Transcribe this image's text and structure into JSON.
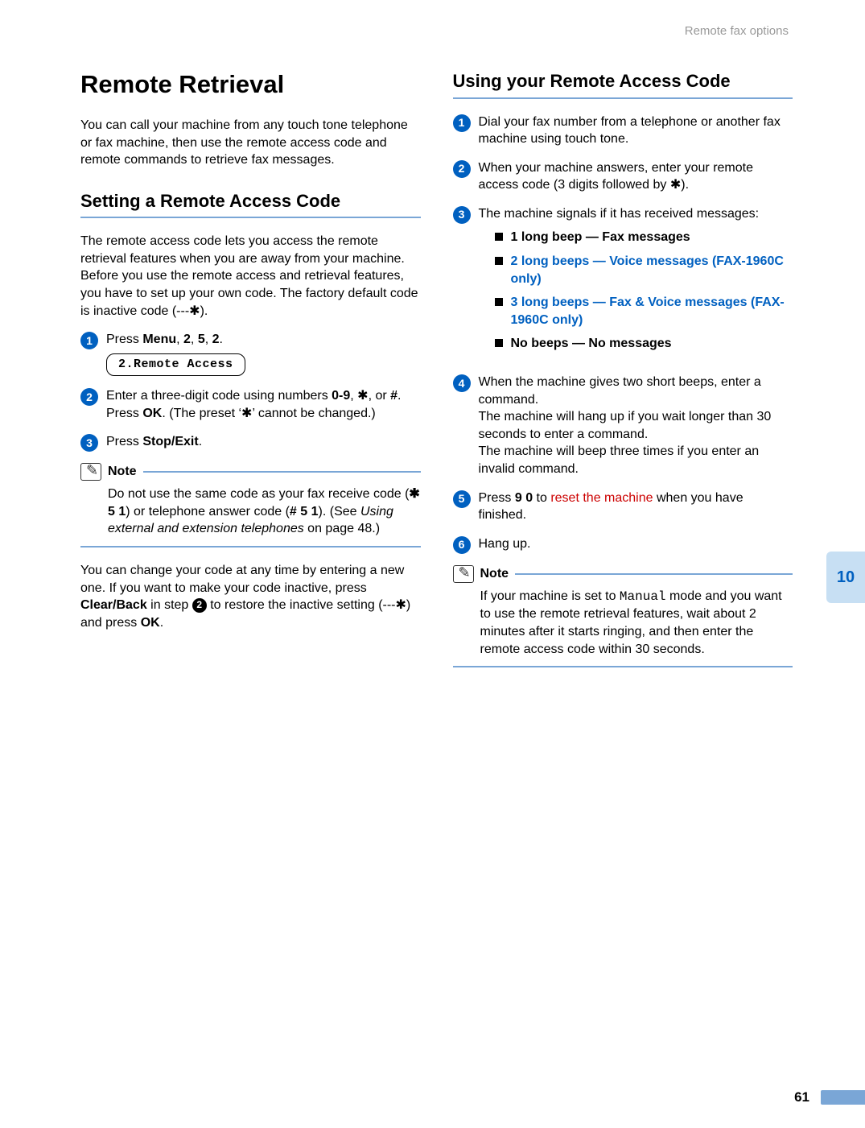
{
  "header": {
    "breadcrumb": "Remote fax options"
  },
  "left": {
    "h1": "Remote Retrieval",
    "intro": "You can call your machine from any touch tone telephone or fax machine, then use the remote access code and remote commands to retrieve fax messages.",
    "h2": "Setting a Remote Access Code",
    "p1_a": "The remote access code lets you access the remote retrieval features when you are away from your machine. Before you use the remote access and retrieval features, you have to set up your own code. The factory default code is inactive code (---",
    "p1_b": ").",
    "star": "✱",
    "steps": {
      "s1_a": "Press ",
      "s1_menu": "Menu",
      "s1_b": ", ",
      "s1_k1": "2",
      "s1_k2": "5",
      "s1_k3": "2",
      "s1_dot": ".",
      "lcd": "2.Remote Access",
      "s2_a": "Enter a three-digit code using numbers ",
      "s2_range": "0-9",
      "s2_b": ", ",
      "s2_star": "✱",
      "s2_c": ", or ",
      "s2_hash": "#",
      "s2_d": ".",
      "s2_e": "Press ",
      "s2_ok": "OK",
      "s2_f": ". (The preset ‘",
      "s2_g": "’ cannot be changed.)",
      "s3_a": "Press ",
      "s3_stop": "Stop/Exit",
      "s3_b": "."
    },
    "note_label": "Note",
    "note_a": "Do not use the same code as your fax receive code (",
    "note_code1": "✱ 5 1",
    "note_b": ") or telephone answer code (",
    "note_code2": "# 5 1",
    "note_c": "). (See ",
    "note_ref": "Using external and extension telephones",
    "note_d": " on page 48.)",
    "p2_a": "You can change your code at any time by entering a new one. If you want to make your code inactive, press ",
    "p2_clear": "Clear/Back",
    "p2_b": " in step ",
    "p2_badge": "2",
    "p2_c": " to restore the inactive setting (---",
    "p2_d": ") and press ",
    "p2_ok": "OK",
    "p2_e": "."
  },
  "right": {
    "h2": "Using your Remote Access Code",
    "s1": "Dial your fax number from a telephone or another fax machine using touch tone.",
    "s2_a": "When your machine answers, enter your remote access code (3 digits followed by ",
    "s2_b": ").",
    "s3": "The machine signals if it has received messages:",
    "bullets": {
      "b1": "1 long beep — Fax messages",
      "b2": "2 long beeps — Voice messages (FAX-1960C only)",
      "b3": "3 long beeps — Fax & Voice messages (FAX-1960C only)",
      "b4": "No beeps — No messages"
    },
    "s4_a": "When the machine gives two short beeps, enter a command.",
    "s4_b": "The machine will hang up if you wait longer than 30 seconds to enter a command.",
    "s4_c": "The machine will beep three times if you enter an invalid command.",
    "s5_a": "Press ",
    "s5_code": "9 0",
    "s5_b": " to ",
    "s5_red": "reset the machine",
    "s5_c": " when you have finished.",
    "s6": "Hang up.",
    "note_label": "Note",
    "note_a": "If your machine is set to ",
    "note_mono": "Manual",
    "note_b": " mode and you want to use the remote retrieval features, wait about 2 minutes after it starts ringing, and then enter the remote access code within 30 seconds."
  },
  "sidebar": {
    "chapter": "10"
  },
  "footer": {
    "page": "61"
  }
}
